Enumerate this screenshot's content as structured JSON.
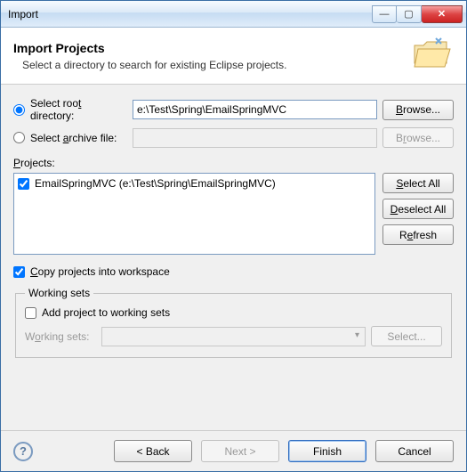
{
  "window": {
    "title": "Import"
  },
  "header": {
    "title": "Import Projects",
    "subtitle": "Select a directory to search for existing Eclipse projects."
  },
  "source": {
    "root_label_pre": "Select roo",
    "root_label_u": "t",
    "root_label_post": " directory:",
    "root_value": "e:\\Test\\Spring\\EmailSpringMVC",
    "archive_label_pre": "Select ",
    "archive_label_u": "a",
    "archive_label_post": "rchive file:",
    "archive_value": "",
    "browse1": "Browse...",
    "browse2": "Browse..."
  },
  "projects": {
    "label": "Projects:",
    "items": [
      {
        "checked": true,
        "text": "EmailSpringMVC (e:\\Test\\Spring\\EmailSpringMVC)"
      }
    ],
    "select_all": "Select All",
    "deselect_all": "Deselect All",
    "refresh": "Refresh"
  },
  "copy": {
    "label": "Copy projects into workspace",
    "checked": true
  },
  "working_sets": {
    "legend": "Working sets",
    "add_label": "Add project to working sets",
    "add_checked": false,
    "combo_label": "Working sets:",
    "select_btn": "Select..."
  },
  "footer": {
    "back": "< Back",
    "next": "Next >",
    "finish": "Finish",
    "cancel": "Cancel"
  }
}
